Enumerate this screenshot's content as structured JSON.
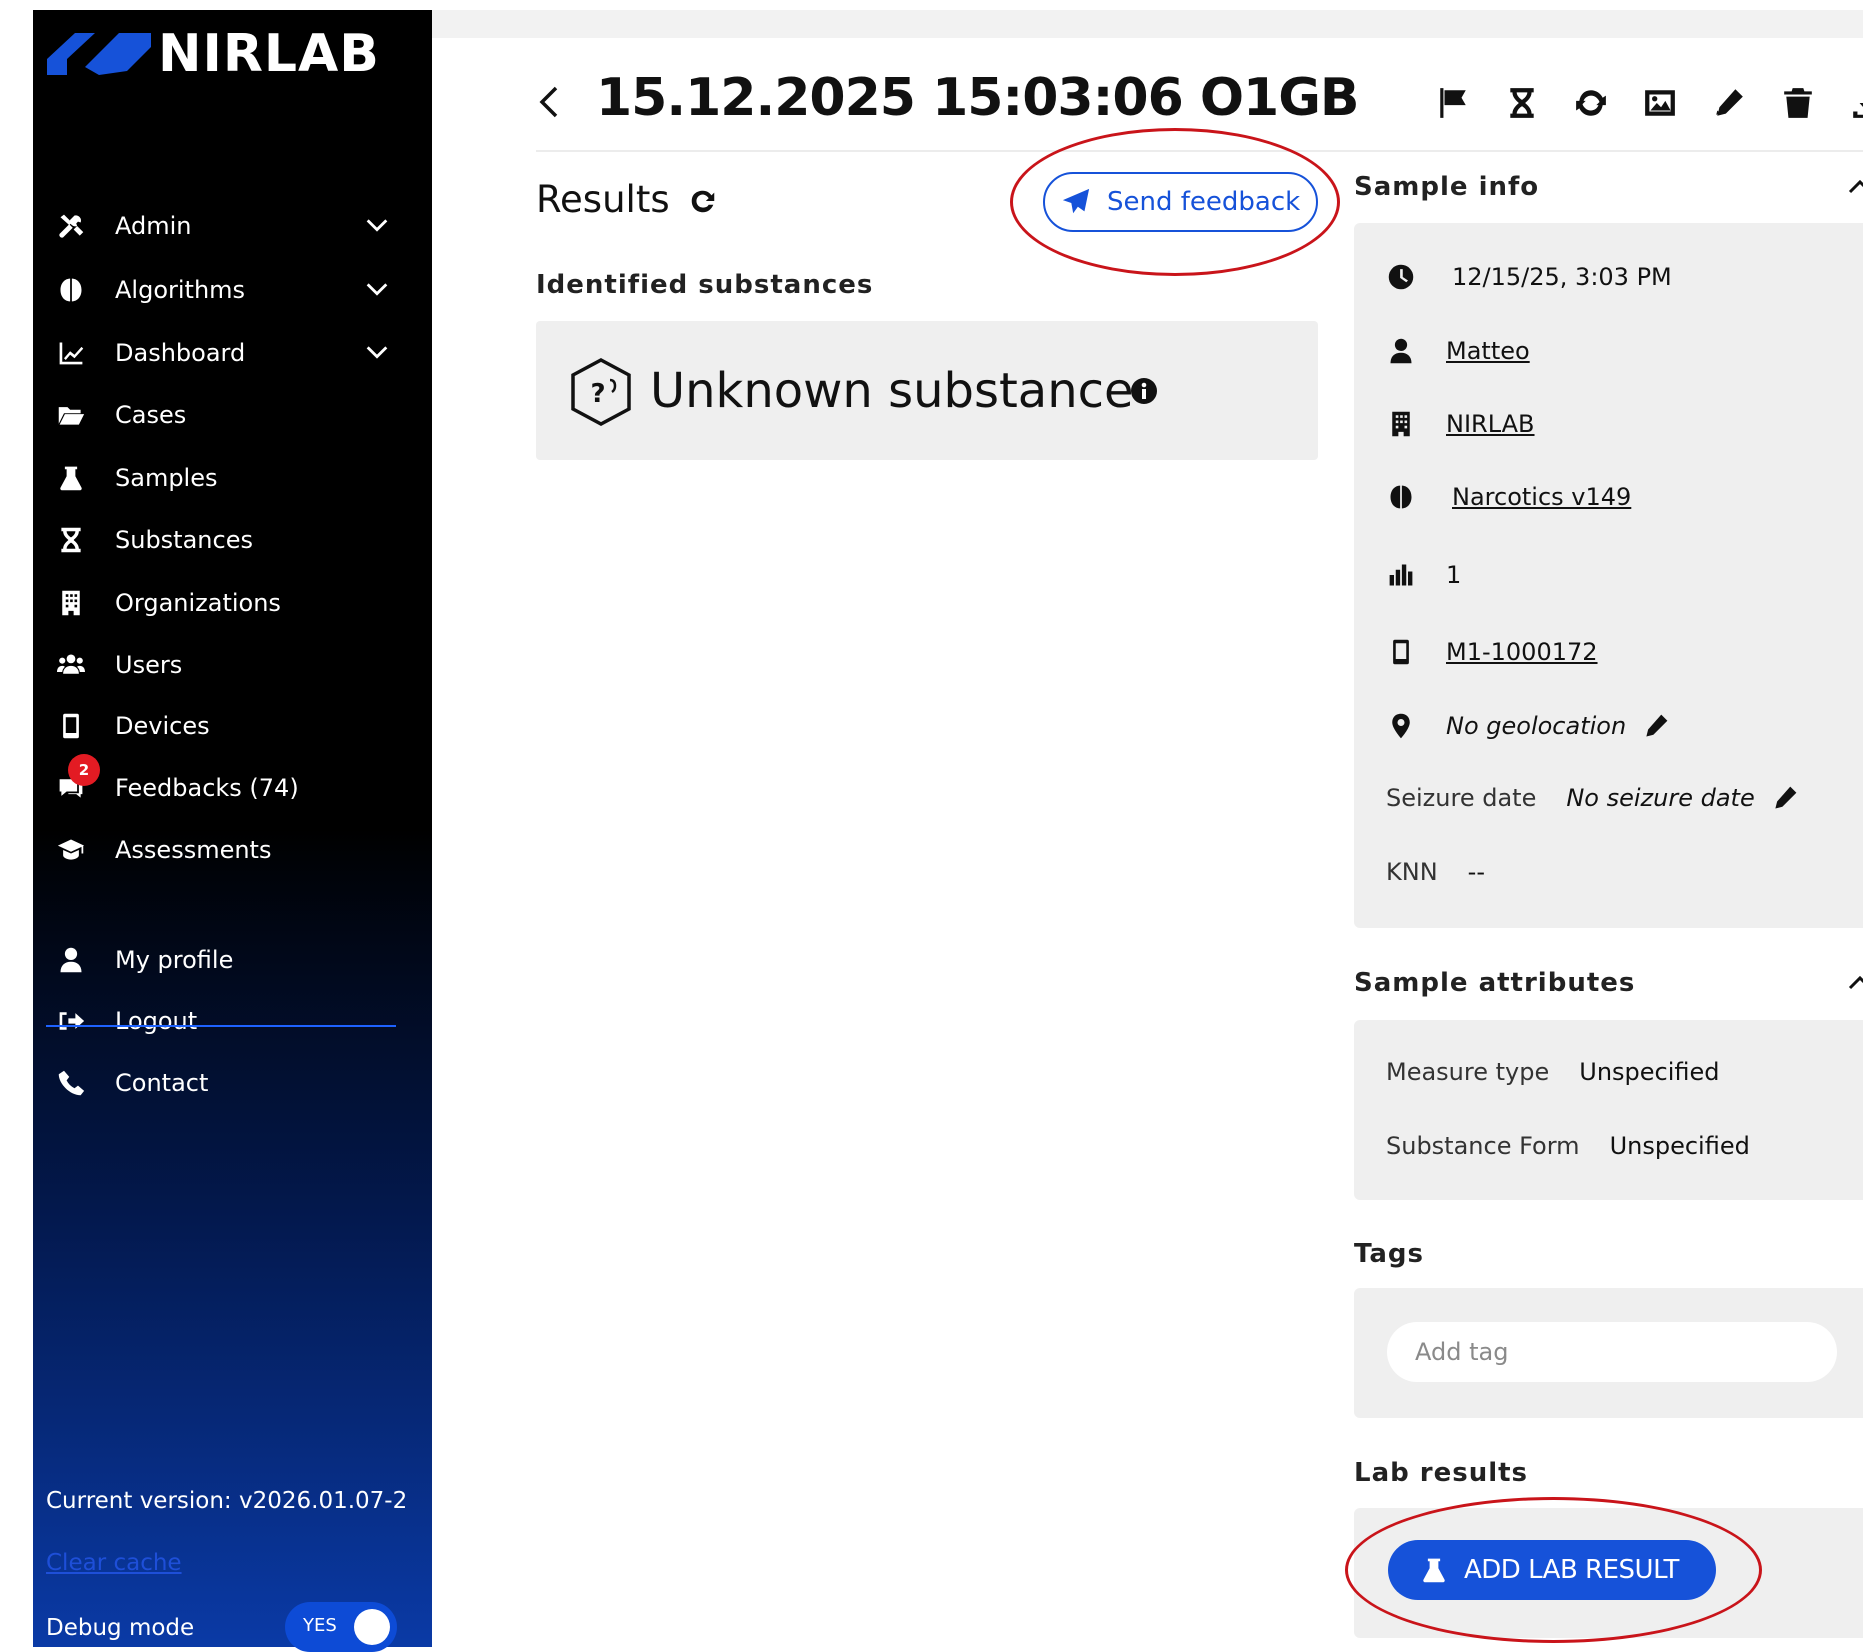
{
  "app": {
    "logo_text": "NIRLAB",
    "brand_color": "#1652d9"
  },
  "sidebar": {
    "items": [
      {
        "label": "Admin",
        "icon": "tools-icon",
        "expandable": true
      },
      {
        "label": "Algorithms",
        "icon": "brain-icon",
        "expandable": true
      },
      {
        "label": "Dashboard",
        "icon": "chart-line-icon",
        "expandable": true
      },
      {
        "label": "Cases",
        "icon": "folder-open-icon",
        "expandable": false
      },
      {
        "label": "Samples",
        "icon": "flask-icon",
        "expandable": false
      },
      {
        "label": "Substances",
        "icon": "hourglass-icon",
        "expandable": false
      },
      {
        "label": "Organizations",
        "icon": "building-icon",
        "expandable": false
      },
      {
        "label": "Users",
        "icon": "users-icon",
        "expandable": false
      },
      {
        "label": "Devices",
        "icon": "mobile-icon",
        "expandable": false
      },
      {
        "label": "Feedbacks (74)",
        "icon": "comments-icon",
        "badge": "2"
      },
      {
        "label": "Assessments",
        "icon": "graduation-cap-icon",
        "expandable": false
      }
    ],
    "secondary_items": [
      {
        "label": "My profile",
        "icon": "user-icon"
      },
      {
        "label": "Logout",
        "icon": "logout-icon"
      },
      {
        "label": "Contact",
        "icon": "phone-icon"
      }
    ],
    "version_text": "Current version: v2026.01.07-2",
    "clear_cache_label": "Clear cache",
    "debug_label": "Debug mode",
    "debug_value": "YES"
  },
  "header": {
    "title": "15.12.2025 15:03:06 O1GB",
    "toolbar_icons": [
      "flag-icon",
      "hourglass-icon",
      "sync-icon",
      "image-icon",
      "pencil-icon",
      "trash-icon",
      "download-icon"
    ]
  },
  "results": {
    "heading": "Results",
    "send_feedback_label": "Send feedback",
    "identified_heading": "Identified substances",
    "substance_name": "Unknown substance"
  },
  "sample_info": {
    "heading": "Sample info",
    "datetime": "12/15/25, 3:03 PM",
    "user": "Matteo",
    "organization": "NIRLAB",
    "algorithm": "Narcotics v149",
    "count": "1",
    "device": "M1-1000172",
    "geolocation": "No geolocation",
    "seizure_label": "Seizure date",
    "seizure_value": "No seizure date",
    "knn_label": "KNN",
    "knn_value": "--"
  },
  "sample_attributes": {
    "heading": "Sample attributes",
    "measure_type_label": "Measure type",
    "measure_type_value": "Unspecified",
    "substance_form_label": "Substance Form",
    "substance_form_value": "Unspecified"
  },
  "tags": {
    "heading": "Tags",
    "placeholder": "Add tag"
  },
  "lab_results": {
    "heading": "Lab results",
    "add_button_label": "ADD LAB RESULT"
  },
  "annotations": {
    "highlight_color": "#c9141a"
  }
}
